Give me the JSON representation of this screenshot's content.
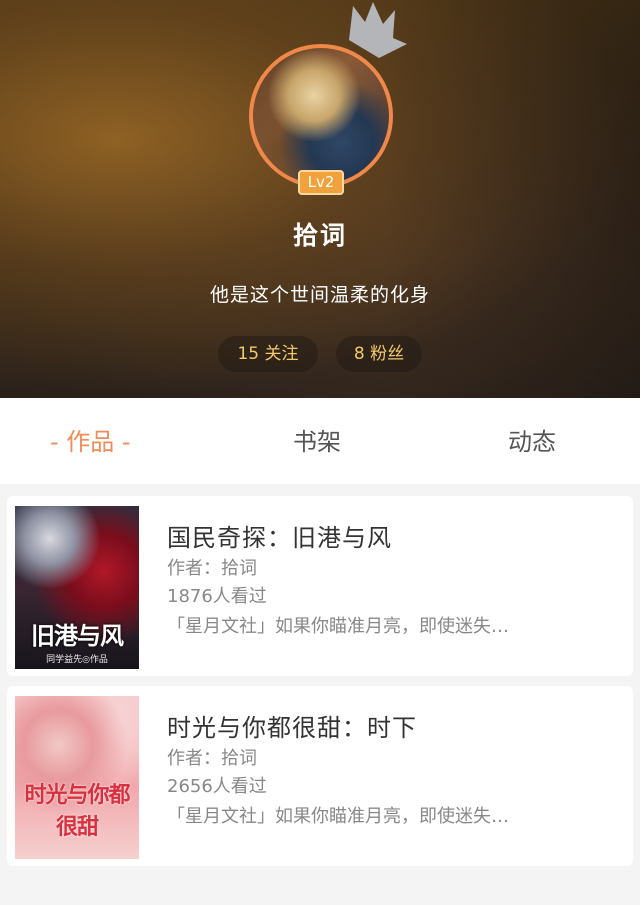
{
  "profile": {
    "level": "Lv2",
    "username": "拾词",
    "bio": "他是这个世间温柔的化身",
    "follow_stat": "15 关注",
    "fans_stat": "8 粉丝"
  },
  "tabs": {
    "works": "- 作品 -",
    "shelf": "书架",
    "feed": "动态"
  },
  "books": [
    {
      "title": "国民奇探：旧港与风",
      "author": "作者：拾词",
      "views": "1876人看过",
      "intro": "「星月文社」如果你瞄准月亮，即使迷失…",
      "cover_text": "旧港与风",
      "cover_sub": "同学益先◎作品"
    },
    {
      "title": "时光与你都很甜：时下",
      "author": "作者：拾词",
      "views": "2656人看过",
      "intro": "「星月文社」如果你瞄准月亮，即使迷失…",
      "cover_text": "时光与你都很甜",
      "cover_sub": ""
    }
  ],
  "colors": {
    "accent": "#ef8c57",
    "badge": "#f2a23c",
    "stat_text": "#f2c96a"
  }
}
